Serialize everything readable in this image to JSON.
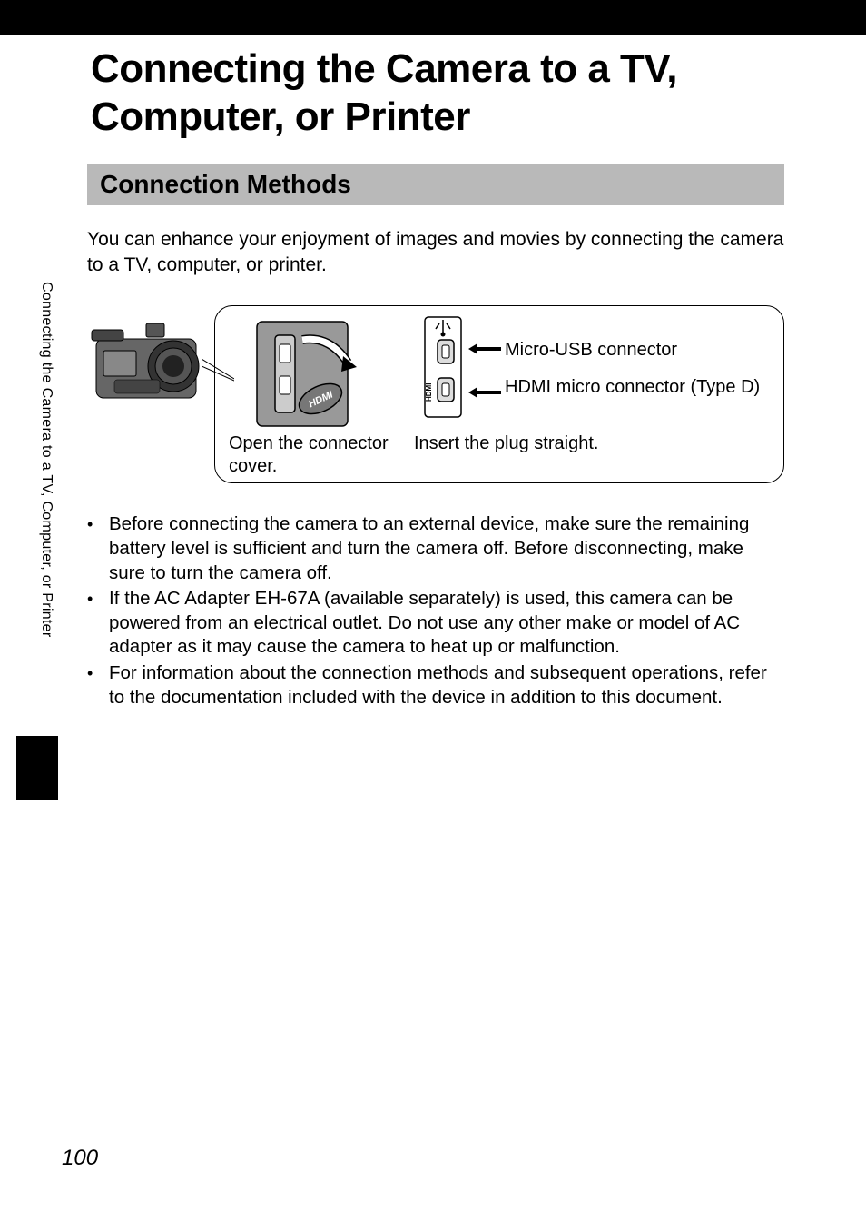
{
  "page_title": "Connecting the Camera to a TV, Computer, or Printer",
  "section_heading": "Connection Methods",
  "intro": "You can enhance your enjoyment of images and movies by connecting the camera to a TV, computer, or printer.",
  "diagram": {
    "open_cover": "Open the connector cover.",
    "insert_plug": "Insert the plug straight.",
    "usb_label": "Micro-USB connector",
    "hdmi_label": "HDMI micro connector (Type D)"
  },
  "bullets": [
    "Before connecting the camera to an external device, make sure the remaining battery level is sufficient and turn the camera off. Before disconnecting, make sure to turn the camera off.",
    "If the AC Adapter EH-67A (available separately) is used, this camera can be powered from an electrical outlet. Do not use any other make or model of AC adapter as it may cause the camera to heat up or malfunction.",
    "For information about the connection methods and subsequent operations, refer to the documentation included with the device in addition to this document."
  ],
  "side_tab_text": "Connecting the Camera to a TV, Computer, or Printer",
  "page_number": "100"
}
